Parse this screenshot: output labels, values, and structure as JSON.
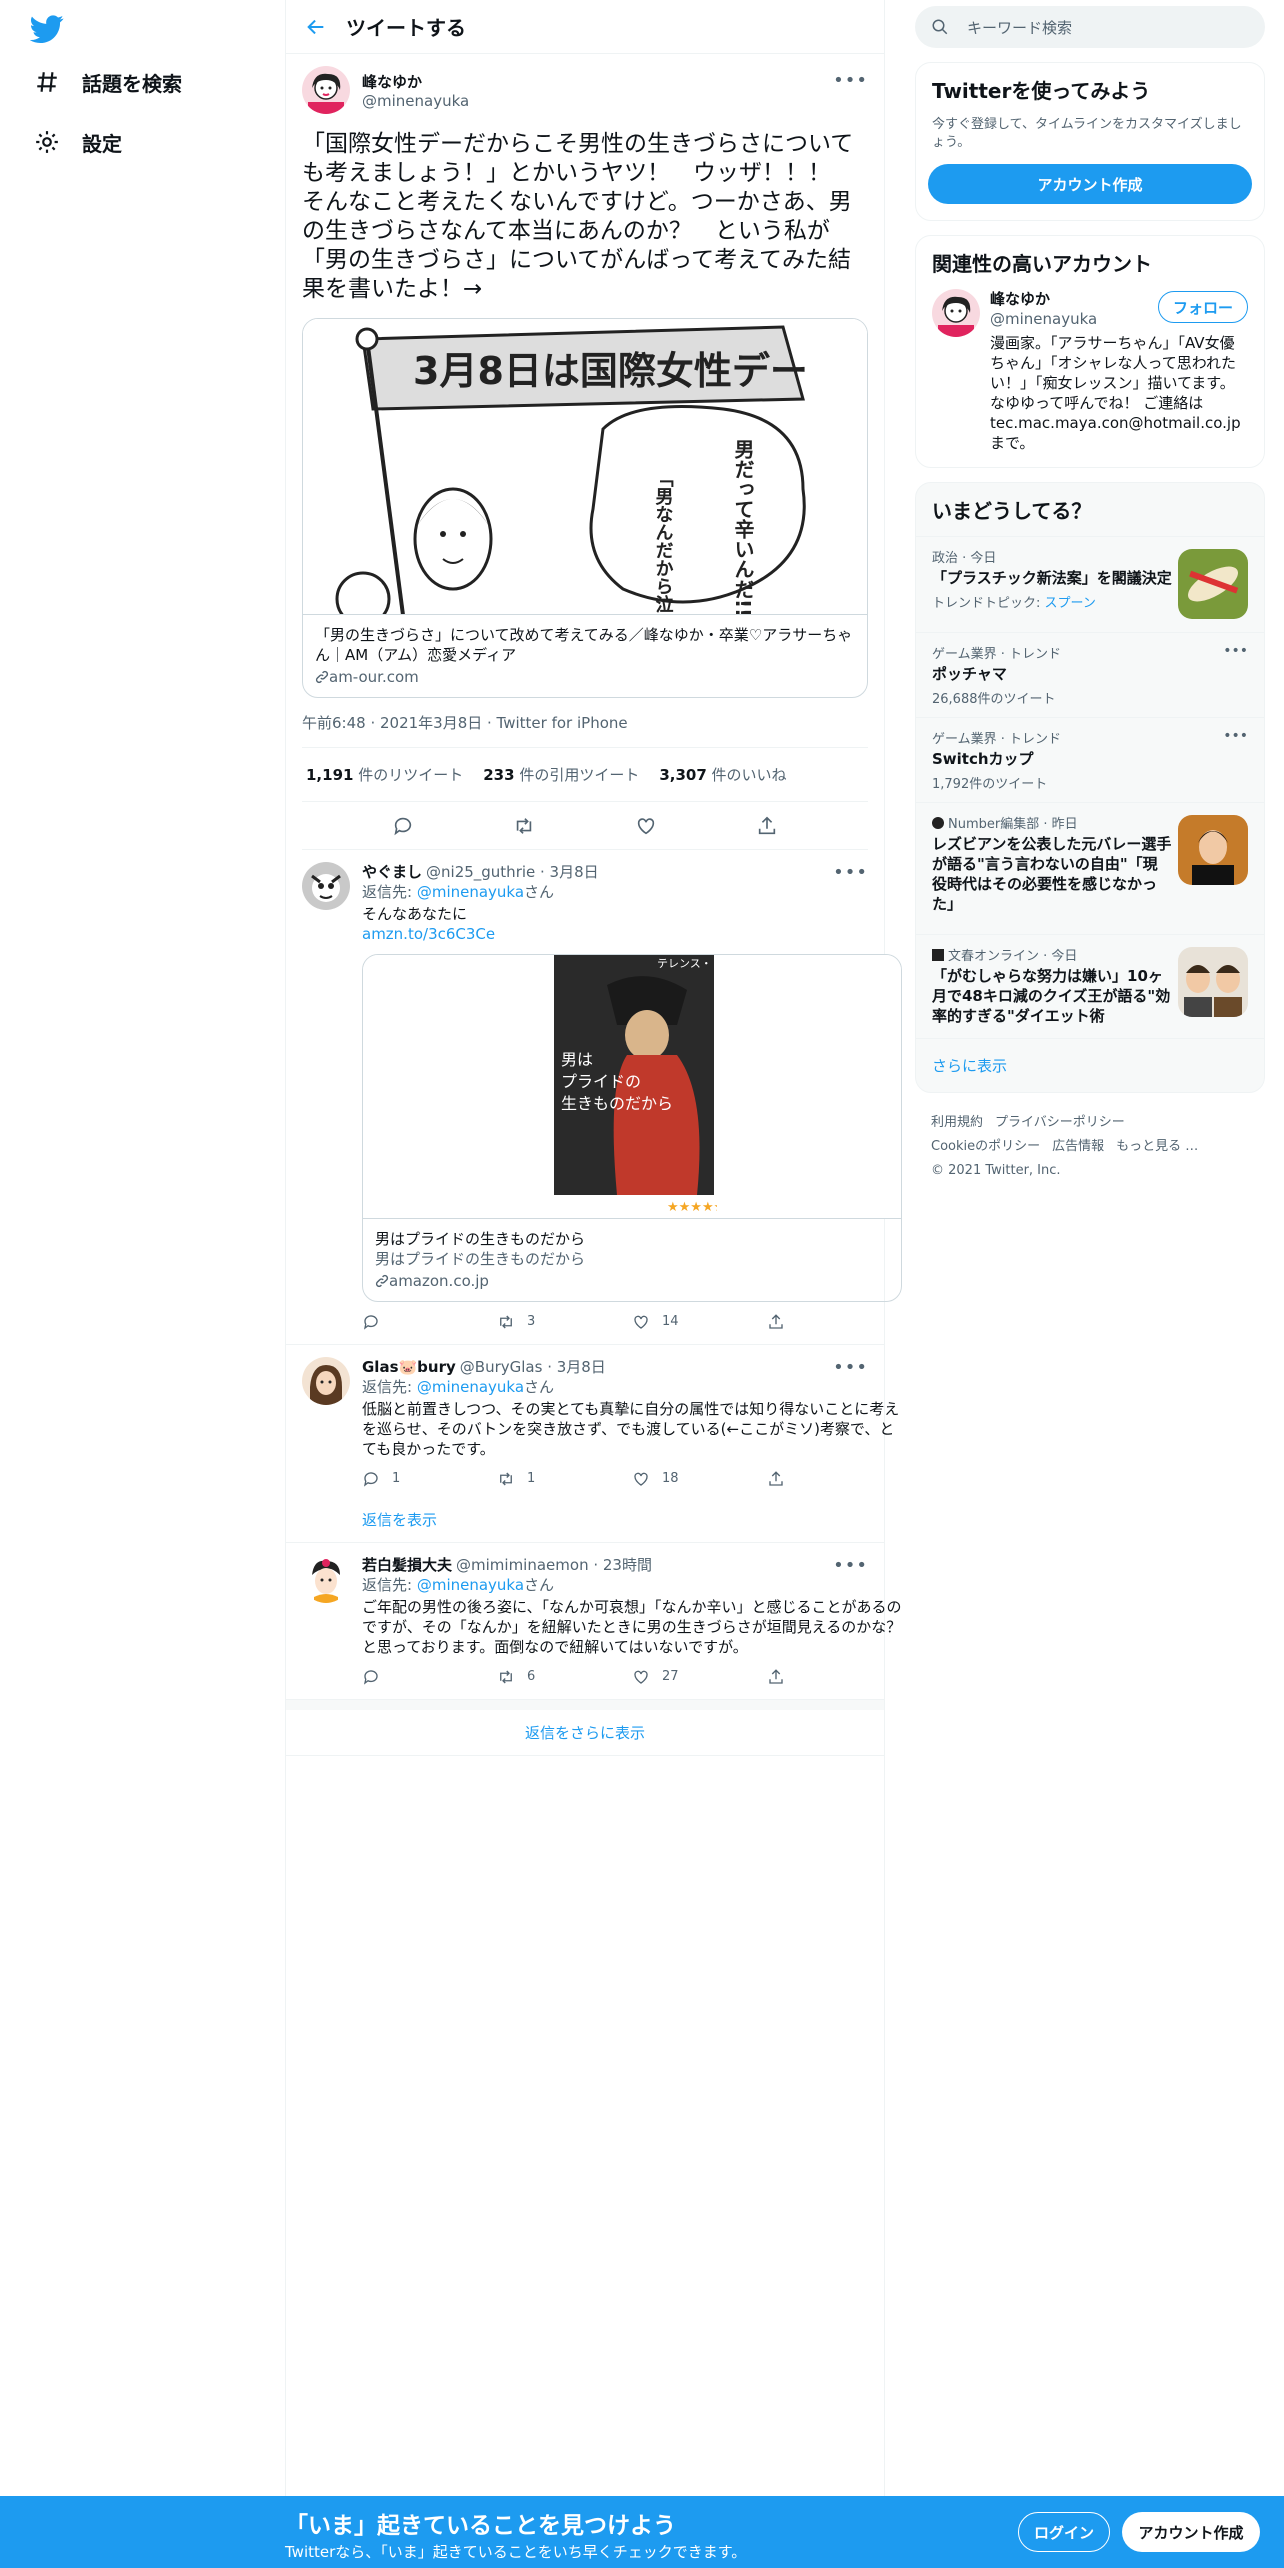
{
  "nav": {
    "explore_label": "話題を検索",
    "settings_label": "設定"
  },
  "header": {
    "title": "ツイートする"
  },
  "main_tweet": {
    "name": "峰なゆか",
    "handle": "@minenayuka",
    "text": "「国際女性デーだからこそ男性の生きづらさについても考えましょう！」とかいうヤツ！　ウッザ！！！　そんなこと考えたくないんですけど。つーかさあ、男の生きづらさなんて本当にあんのか？　という私が「男の生きづらさ」についてがんばって考えてみた結果を書いたよ！→",
    "card": {
      "title": "「男の生きづらさ」について改めて考えてみる／峰なゆか・卒業♡アラサーちゃん｜AM（アム）恋愛メディア",
      "domain": "am-our.com",
      "img_banner": "3月8日は国際女性デー",
      "img_bubble1": "男だって辛いんだ!!",
      "img_bubble2": "「男なんだから泣くな」って言われる!!"
    },
    "meta": "午前6:48 · 2021年3月8日 · Twitter for iPhone",
    "retweets_count": "1,191",
    "retweets_label": " 件のリツイート",
    "quotes_count": "233",
    "quotes_label": " 件の引用ツイート",
    "likes_count": "3,307",
    "likes_label": " 件のいいね"
  },
  "replies": [
    {
      "name": "やぐまし",
      "handle_time": "@ni25_guthrie · 3月8日",
      "reply_to_prefix": "返信先: ",
      "reply_to_handle": "@minenayuka",
      "reply_to_suffix": "さん",
      "text": "そんなあなたに",
      "link": "amzn.to/3c6C3Ce",
      "card": {
        "book_title": "男はプライドの生きものだから",
        "book_author": "テレンス・リアル",
        "title": "男はプライドの生きものだから",
        "subtitle": "男はプライドの生きものだから",
        "domain": "amazon.co.jp",
        "stars": "★★★★★"
      },
      "reply_count": "",
      "retweet_count": "3",
      "like_count": "14"
    },
    {
      "name": "Glas🐷bury",
      "handle_time": "@BuryGlas · 3月8日",
      "reply_to_prefix": "返信先: ",
      "reply_to_handle": "@minenayuka",
      "reply_to_suffix": "さん",
      "text": "低脳と前置きしつつ、その実とても真摯に自分の属性では知り得ないことに考えを巡らせ、そのバトンを突き放さず、でも渡している(←ここがミソ)考察で、とても良かったです。",
      "reply_count": "1",
      "retweet_count": "1",
      "like_count": "18",
      "show_replies": "返信を表示"
    },
    {
      "name": "若白髪損大夫",
      "handle_time": "@mimiminaemon · 23時間",
      "reply_to_prefix": "返信先: ",
      "reply_to_handle": "@minenayuka",
      "reply_to_suffix": "さん",
      "text": "ご年配の男性の後ろ姿に、「なんか可哀想」「なんか辛い」と感じることがあるのですが、その「なんか」を紐解いたときに男の生きづらさが垣間見えるのかな？と思っております。面倒なので紐解いてはいないですが。",
      "reply_count": "",
      "retweet_count": "6",
      "like_count": "27"
    }
  ],
  "show_more_replies": "返信をさらに表示",
  "sidebar": {
    "search_placeholder": "キーワード検索",
    "signup": {
      "title": "Twitterを使ってみよう",
      "subtitle": "今すぐ登録して、タイムラインをカスタマイズしましょう。",
      "button": "アカウント作成"
    },
    "relevant": {
      "title": "関連性の高いアカウント",
      "name": "峰なゆか",
      "handle": "@minenayuka",
      "follow": "フォロー",
      "bio": "漫画家。「アラサーちゃん」「AV女優ちゃん」「オシャレな人って思われたい！」「痴女レッスン」描いてます。なゆゆって呼んでね！ ご連絡は tec.mac.maya.con@hotmail.co.jp まで。"
    },
    "trends": {
      "title": "いまどうしてる？",
      "items": [
        {
          "meta": "政治 · 今日",
          "name": "「プラスチック新法案」を閣議決定",
          "extra_prefix": "トレンドトピック: ",
          "extra_link": "スプーン"
        },
        {
          "meta": "ゲーム業界 · トレンド",
          "name": "ポッチャマ",
          "count": "26,688件のツイート"
        },
        {
          "meta": "ゲーム業界 · トレンド",
          "name": "Switchカップ",
          "count": "1,792件のツイート"
        },
        {
          "meta": "Number編集部 · 昨日",
          "name": "レズビアンを公表した元バレー選手が語る\"言う言わないの自由\"「現役時代はその必要性を感じなかった」"
        },
        {
          "meta": "文春オンライン · 今日",
          "name": "「がむしゃらな努力は嫌い」10ヶ月で48キロ減のクイズ王が語る\"効率的すぎる\"ダイエット術"
        }
      ],
      "show_more": "さらに表示"
    },
    "footer": {
      "terms": "利用規約",
      "privacy": "プライバシーポリシー",
      "cookie": "Cookieのポリシー",
      "ads": "広告情報",
      "more": "もっと見る …",
      "copyright": "© 2021 Twitter, Inc."
    }
  },
  "bottom_bar": {
    "title": "「いま」起きていることを見つけよう",
    "subtitle": "Twitterなら、「いま」起きていることをいち早くチェックできます。",
    "login": "ログイン",
    "signup": "アカウント作成"
  },
  "colors": {
    "accent": "#1d9bf0",
    "text": "#0f1419",
    "muted": "#536471",
    "border": "#eff3f4"
  },
  "icons": [
    "twitter-logo-icon",
    "hashtag-icon",
    "gear-icon",
    "back-arrow-icon",
    "more-icon",
    "reply-icon",
    "retweet-icon",
    "like-icon",
    "share-icon",
    "link-icon",
    "search-icon",
    "verified-icon"
  ]
}
